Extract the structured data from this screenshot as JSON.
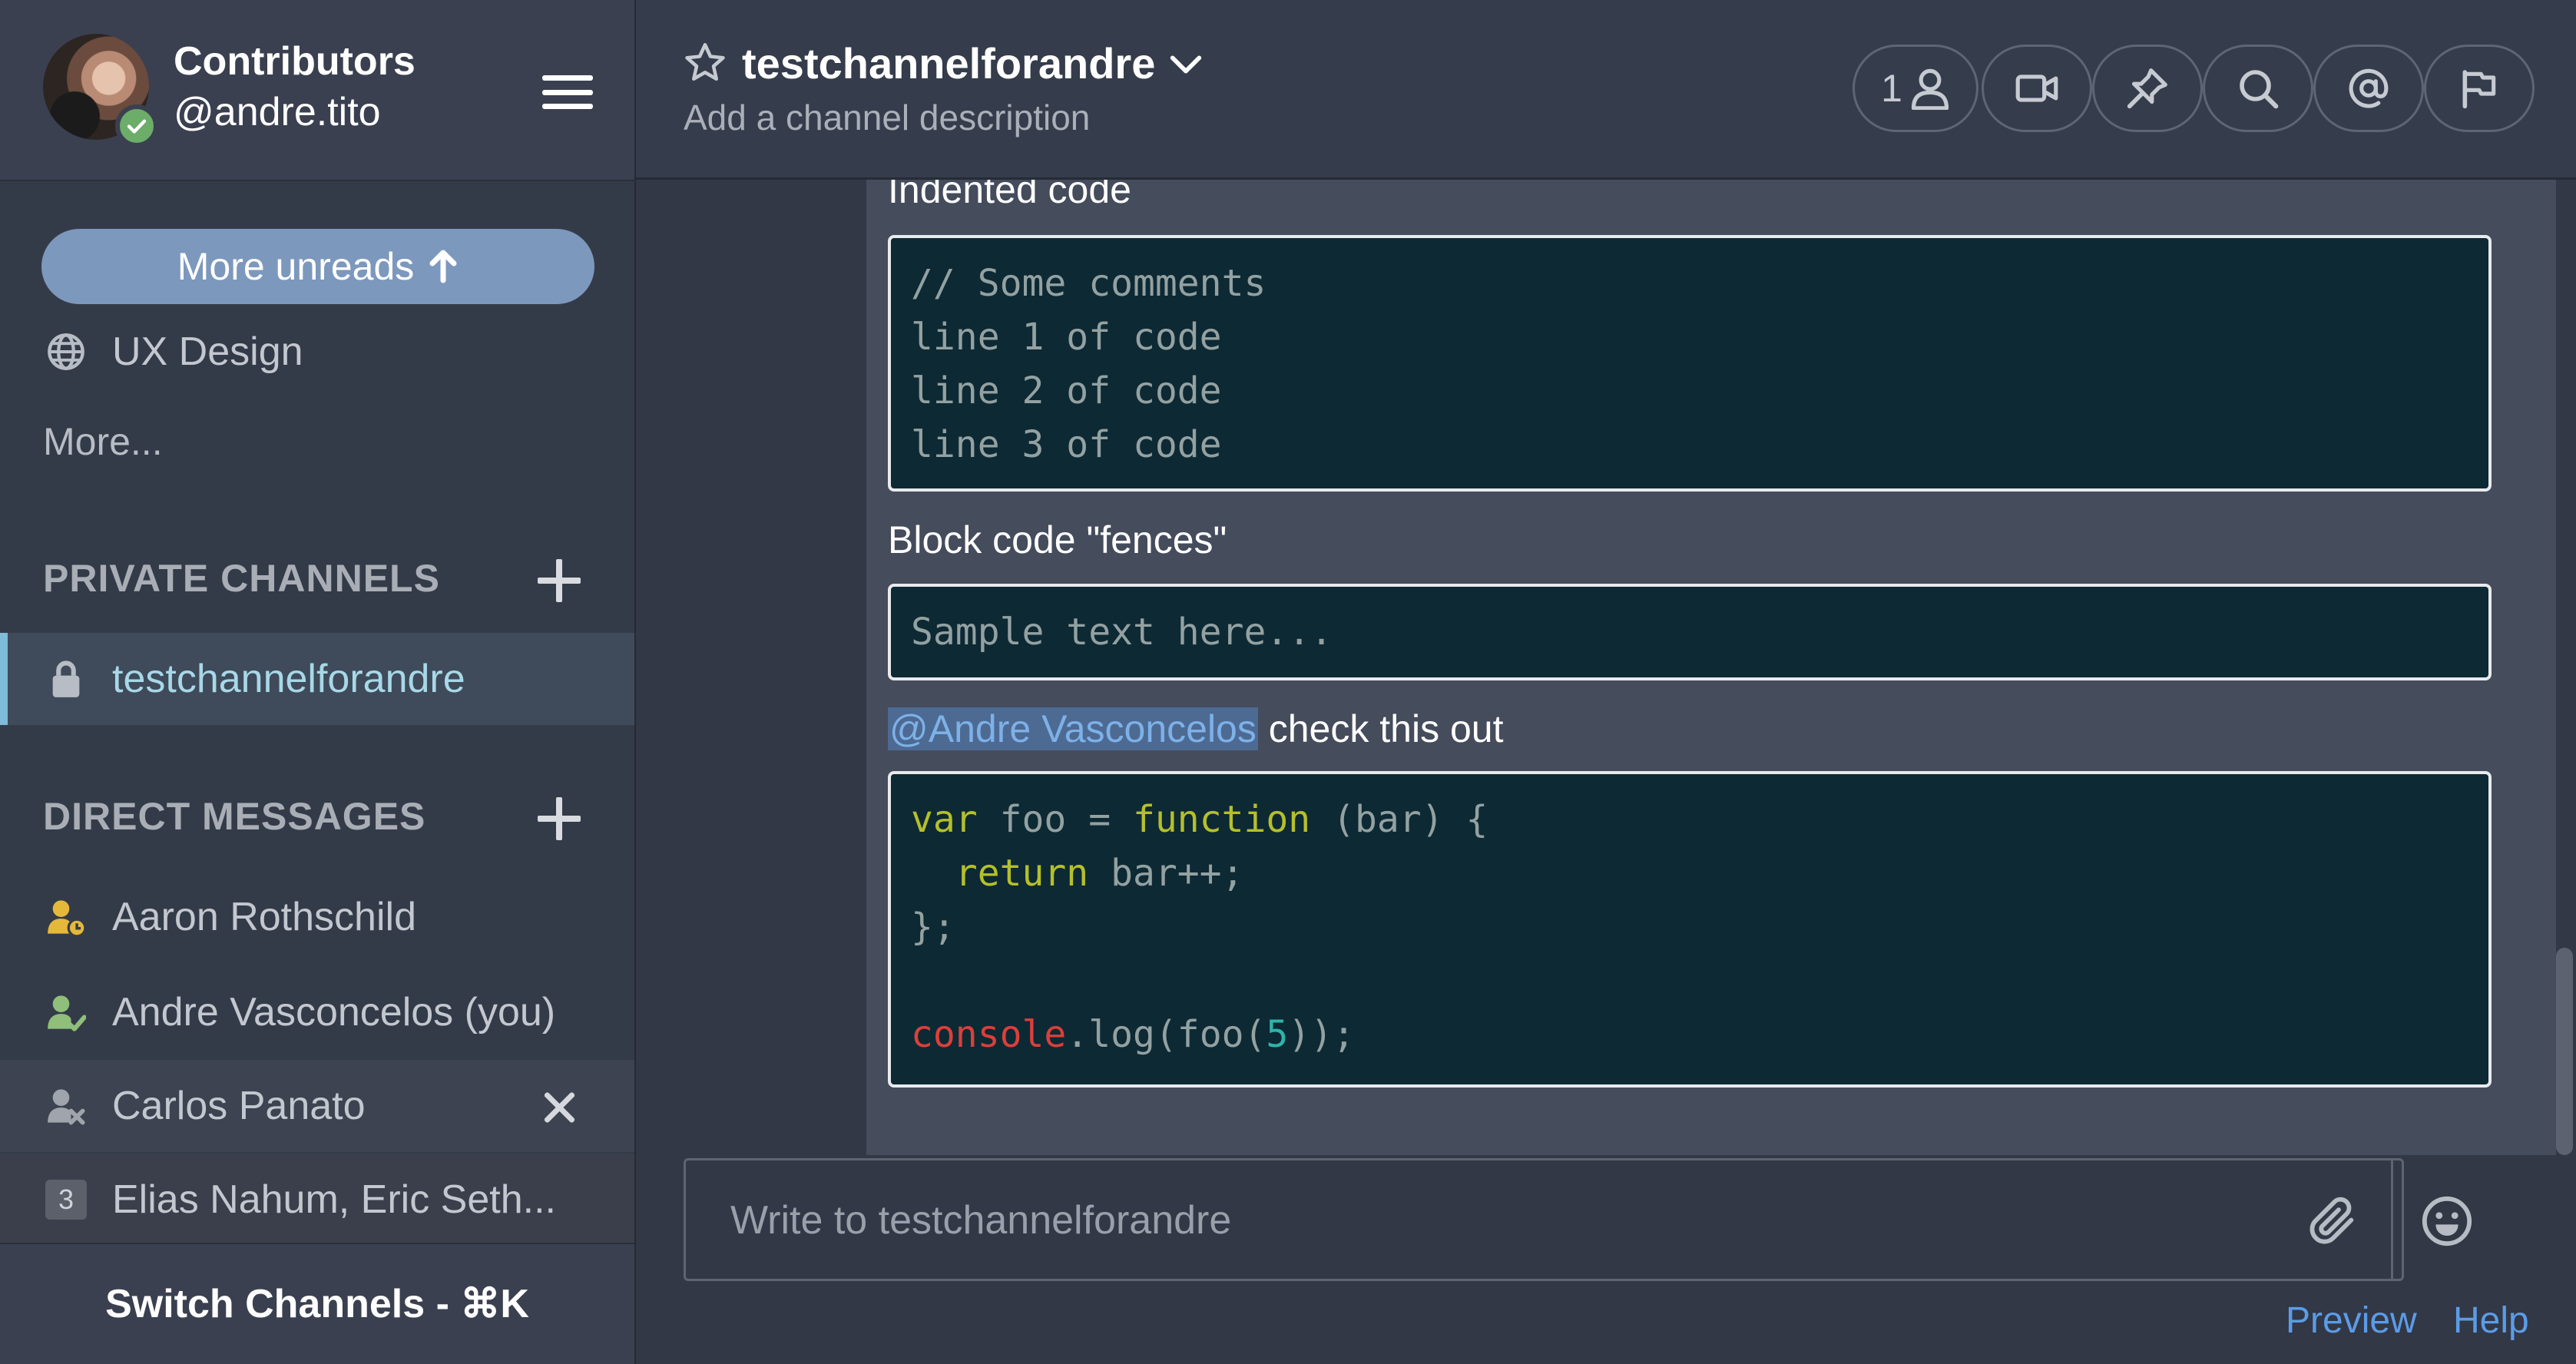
{
  "sidebar": {
    "team_name": "Contributors",
    "username": "@andre.tito",
    "more_unreads": "More unreads",
    "public_item": "UX Design",
    "more_link": "More...",
    "private_title": "PRIVATE CHANNELS",
    "private_channels": [
      {
        "label": "testchannelforandre",
        "active": true
      }
    ],
    "direct_title": "DIRECT MESSAGES",
    "direct_messages": [
      {
        "label": "Aaron Rothschild",
        "status": "away"
      },
      {
        "label": "Andre Vasconcelos (you)",
        "status": "online"
      },
      {
        "label": "Carlos Panato",
        "status": "offline"
      },
      {
        "label": "Elias Nahum, Eric Seth...",
        "status": "group",
        "count": "3"
      }
    ],
    "switch_channels": "Switch Channels - ⌘K"
  },
  "header": {
    "channel_name": "testchannelforandre",
    "description": "Add a channel description",
    "member_count": "1"
  },
  "post": {
    "indented_label": "Indented code",
    "indented_code": "// Some comments\nline 1 of code\nline 2 of code\nline 3 of code",
    "fences_label": "Block code \"fences\"",
    "fences_code": "Sample text here...",
    "mention": "@Andre Vasconcelos",
    "mention_rest": " check this out"
  },
  "input": {
    "placeholder": "Write to testchannelforandre"
  },
  "footer": {
    "preview": "Preview",
    "help": "Help"
  },
  "colors": {
    "sidebar_bg": "#343b48",
    "active_marker": "#7fbcd9",
    "more_unreads_bg": "#7d98bd",
    "link": "#5b9ce8",
    "code_bg": "#0d2934",
    "away": "#e4b83b",
    "online": "#8fbf7a"
  }
}
